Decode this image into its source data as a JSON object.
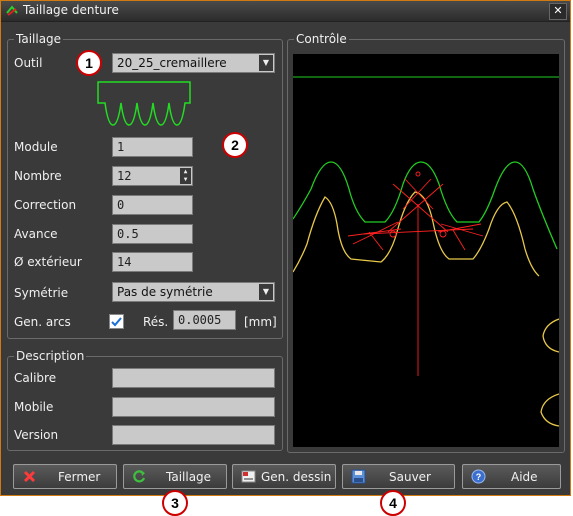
{
  "window": {
    "title": "Taillage denture",
    "close_glyph": "✕"
  },
  "taillage": {
    "group_title": "Taillage",
    "outil_label": "Outil",
    "outil_value": "20_25_cremaillere",
    "module_label": "Module",
    "module_value": "1",
    "nombre_label": "Nombre",
    "nombre_value": "12",
    "correction_label": "Correction",
    "correction_value": "0",
    "avance_label": "Avance",
    "avance_value": "0.5",
    "exterieur_label": "Ø extérieur",
    "exterieur_value": "14",
    "symetrie_label": "Symétrie",
    "symetrie_value": "Pas de symétrie",
    "gen_arcs_label": "Gen. arcs",
    "gen_arcs_checked": true,
    "res_label": "Rés.",
    "res_value": "0.0005",
    "res_unit": "[mm]"
  },
  "description": {
    "group_title": "Description",
    "calibre_label": "Calibre",
    "calibre_value": "",
    "mobile_label": "Mobile",
    "mobile_value": "",
    "version_label": "Version",
    "version_value": ""
  },
  "controle": {
    "group_title": "Contrôle"
  },
  "buttons": {
    "fermer": "Fermer",
    "taillage": "Taillage",
    "gen_dessin": "Gen. dessin",
    "sauver": "Sauver",
    "aide": "Aide"
  },
  "badges": {
    "b1": "1",
    "b2": "2",
    "b3": "3",
    "b4": "4"
  },
  "colors": {
    "accent_border": "#d07a10",
    "badge_ring": "#cc0000",
    "profile_green": "#22cc22",
    "profile_yellow": "#e8c84a",
    "construction_red": "#ff2020"
  }
}
